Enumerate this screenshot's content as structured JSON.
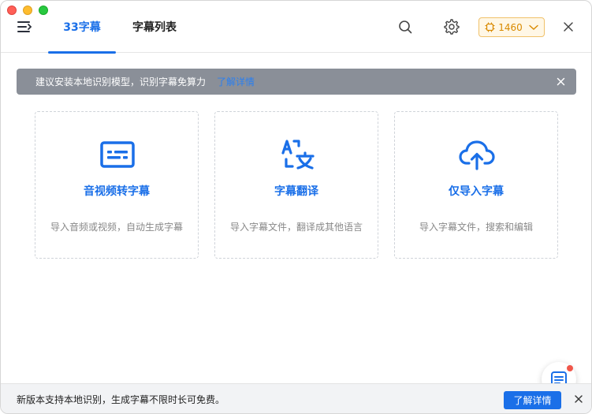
{
  "header": {
    "tabs": [
      {
        "label": "33字幕"
      },
      {
        "label": "字幕列表"
      }
    ],
    "credits": "1460"
  },
  "banner": {
    "text": "建议安装本地识别模型，识别字幕免算力",
    "link": "了解详情"
  },
  "cards": [
    {
      "title": "音视频转字幕",
      "desc": "导入音频或视频，自动生成字幕",
      "icon": "subtitle-icon"
    },
    {
      "title": "字幕翻译",
      "desc": "导入字幕文件，翻译成其他语言",
      "icon": "translate-icon"
    },
    {
      "title": "仅导入字幕",
      "desc": "导入字幕文件，搜索和编辑",
      "icon": "cloud-upload-icon"
    }
  ],
  "bottom": {
    "text": "新版本支持本地识别，生成字幕不限时长可免费。",
    "button": "了解详情"
  },
  "colors": {
    "accent": "#1a6fe8",
    "banner_bg": "#8a8f98",
    "credits_border": "#f0c16a"
  }
}
